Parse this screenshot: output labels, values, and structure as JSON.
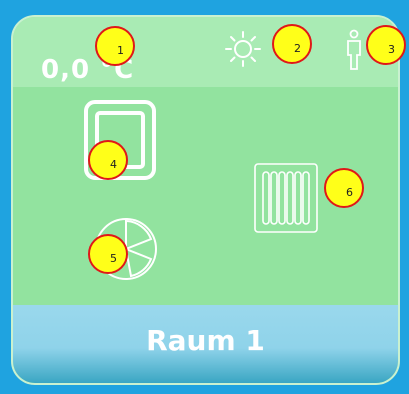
{
  "tile": {
    "temperature": "0,0 °C",
    "room_name": "Raum 1"
  },
  "icons": {
    "light": "sun-icon",
    "presence": "person-icon",
    "window": "window-icon",
    "radiator": "radiator-icon",
    "ventilation": "fan-icon"
  },
  "markers": [
    "1",
    "2",
    "3",
    "4",
    "5",
    "6"
  ],
  "colors": {
    "background": "#1fa3e0",
    "tile": "#92e39f",
    "header": "#a9ebb4",
    "footer_top": "#9ad8ec",
    "footer_bottom": "#3aa6c3",
    "marker_fill": "#ffff19",
    "marker_border": "#e01818"
  }
}
